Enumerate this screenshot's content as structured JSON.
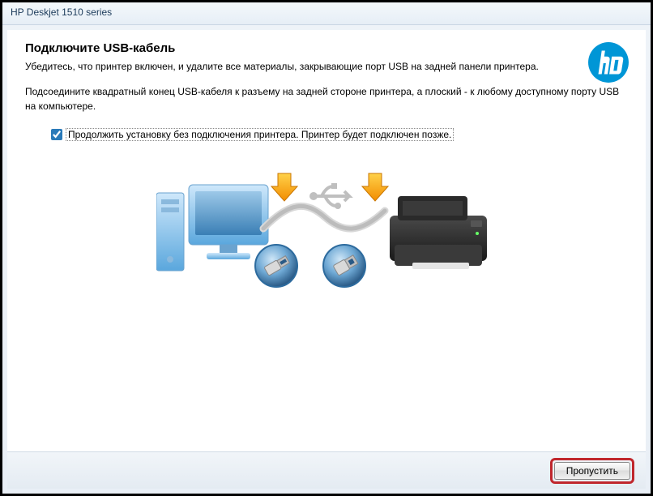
{
  "window": {
    "title": "HP Deskjet 1510 series"
  },
  "header": {
    "heading": "Подключите USB-кабель",
    "subheading": "Убедитесь, что принтер включен, и удалите все материалы, закрывающие порт USB на задней панели принтера."
  },
  "instruction": "Подсоедините квадратный конец USB-кабеля к разъему на задней стороне принтера, а плоский - к любому доступному порту USB на компьютере.",
  "checkbox": {
    "checked": true,
    "label": "Продолжить установку без подключения принтера. Принтер будет подключен позже."
  },
  "footer": {
    "skip_label": "Пропустить"
  },
  "brand": {
    "name": "hp"
  }
}
